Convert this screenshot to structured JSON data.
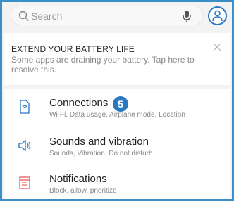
{
  "search": {
    "placeholder": "Search"
  },
  "icons": {
    "search": "search-icon",
    "mic": "mic-icon",
    "profile": "profile-icon",
    "close": "close-icon",
    "connections": "connections-icon",
    "sounds": "sound-icon",
    "notifications": "notifications-icon"
  },
  "colors": {
    "accent": "#2a78c2",
    "frame_border": "#3a8fc9",
    "notifications_icon": "#e45a5a",
    "settings_icon": "#2a78c2"
  },
  "battery_card": {
    "title": "EXTEND YOUR BATTERY LIFE",
    "body": "Some apps are draining your battery. Tap here to resolve this."
  },
  "settings": {
    "items": [
      {
        "title": "Connections",
        "subtitle": "Wi-Fi, Data usage, Airplane mode, Location",
        "callout": "5"
      },
      {
        "title": "Sounds and vibration",
        "subtitle": "Sounds, Vibration, Do not disturb"
      },
      {
        "title": "Notifications",
        "subtitle": "Block, allow, prioritize"
      }
    ]
  }
}
